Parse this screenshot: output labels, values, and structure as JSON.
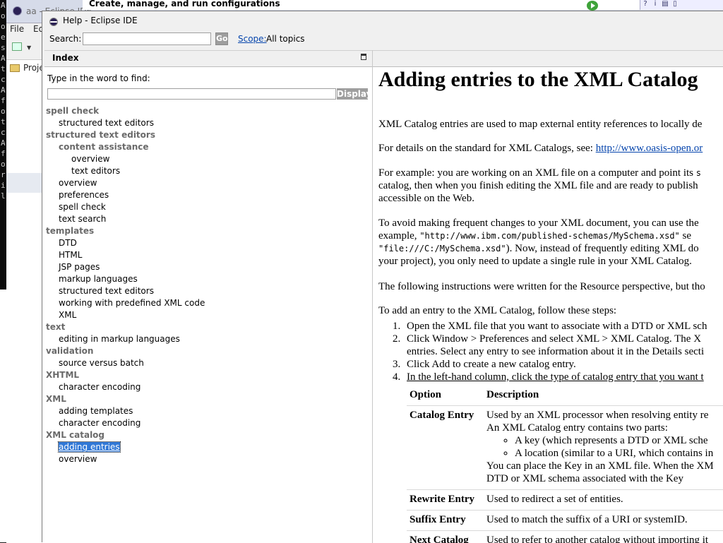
{
  "background": {
    "console_strip": [
      "A",
      "o",
      "o",
      "e",
      "",
      "",
      "",
      "s",
      "A",
      "t",
      "c",
      "A",
      "f",
      "o",
      "t",
      "c",
      "A",
      "f",
      "o",
      "r",
      "i",
      "l"
    ],
    "ide_title": "aa - Eclipse IDE",
    "menu": {
      "file": "File",
      "edit": "Ed"
    },
    "project_tab": "Proje",
    "wizard_title": "Create, manage, and run configurations"
  },
  "help": {
    "window_title": "Help - Eclipse IDE",
    "search": {
      "label": "Search:",
      "value": "",
      "go_label": "Go"
    },
    "scope": {
      "label": "Scope:",
      "value": "All topics"
    },
    "index": {
      "title": "Index",
      "prompt": "Type in the word to find:",
      "input_value": "",
      "display_label": "Display",
      "entries": [
        {
          "label": "spell check",
          "level": 0
        },
        {
          "label": "structured text editors",
          "level": 1
        },
        {
          "label": "structured text editors",
          "level": 0
        },
        {
          "label": "content assistance",
          "level": 1,
          "bold": true
        },
        {
          "label": "overview",
          "level": 2
        },
        {
          "label": "text editors",
          "level": 2
        },
        {
          "label": "overview",
          "level": 1
        },
        {
          "label": "preferences",
          "level": 1
        },
        {
          "label": "spell check",
          "level": 1
        },
        {
          "label": "text search",
          "level": 1
        },
        {
          "label": "templates",
          "level": 0
        },
        {
          "label": "DTD",
          "level": 1
        },
        {
          "label": "HTML",
          "level": 1
        },
        {
          "label": "JSP pages",
          "level": 1
        },
        {
          "label": "markup languages",
          "level": 1
        },
        {
          "label": "structured text editors",
          "level": 1
        },
        {
          "label": "working with predefined XML code",
          "level": 1
        },
        {
          "label": "XML",
          "level": 1
        },
        {
          "label": "text",
          "level": 0
        },
        {
          "label": "editing in markup languages",
          "level": 1
        },
        {
          "label": "validation",
          "level": 0
        },
        {
          "label": "source versus batch",
          "level": 1
        },
        {
          "label": "XHTML",
          "level": 0
        },
        {
          "label": "character encoding",
          "level": 1
        },
        {
          "label": "XML",
          "level": 0
        },
        {
          "label": "adding templates",
          "level": 1
        },
        {
          "label": "character encoding",
          "level": 1
        },
        {
          "label": "XML catalog",
          "level": 0
        },
        {
          "label": "adding entries",
          "level": 1,
          "selected": true
        },
        {
          "label": "overview",
          "level": 1
        }
      ]
    },
    "content": {
      "heading": "Adding entries to the XML Catalog",
      "p1": "XML Catalog entries are used to map external entity references to locally de",
      "p2_prefix": "For details on the standard for XML Catalogs, see: ",
      "p2_link": "http://www.oasis-open.or",
      "p3_a": "For example: you are working on an XML file on a computer and point its ",
      "p3_a_code": "s",
      "p3_b": "catalog, then when you finish editing the XML file and are ready to publish",
      "p3_c": "accessible on the Web.",
      "p4_a": "To avoid making frequent changes to your XML document, you can use the",
      "p4_b_prefix": "example, ",
      "p4_b_code": "\"http://www.ibm.com/published-schemas/MySchema.xsd\"",
      "p4_b_suffix": " se",
      "p4_c_code": "\"file:///C:/MySchema.xsd\"",
      "p4_c_suffix": "). Now, instead of frequently editing XML do",
      "p4_d": "your project), you only need to update a single rule in your XML Catalog.",
      "p5": "The following instructions were written for the Resource perspective, but tho",
      "p6": "To add an entry to the XML Catalog, follow these steps:",
      "steps": [
        {
          "num": "1.",
          "text": "Open the XML file that you want to associate with a DTD or XML sch"
        },
        {
          "num": "2.",
          "text": "Click Window > Preferences and select XML > XML Catalog. The X"
        },
        {
          "num": "",
          "text": "entries. Select any entry to see information about it in the Details secti"
        },
        {
          "num": "3.",
          "text": "Click Add to create a new catalog entry."
        },
        {
          "num": "4.",
          "text": "In the left-hand column, click the type of catalog entry that you want t"
        }
      ],
      "table": {
        "headers": [
          "Option",
          "Description"
        ],
        "rows": [
          {
            "option": "Catalog Entry",
            "d1": "Used by an XML processor when resolving entity re",
            "d2": "An XML Catalog entry contains two parts:",
            "bullet1": "A key (which represents a DTD or XML sche",
            "bullet2": "A location (similar to a URI, which contains in",
            "d3": "You can place the Key in an XML file. When the XM",
            "d4": "DTD or XML schema associated with the Key"
          },
          {
            "option": "Rewrite Entry",
            "d1": "Used to redirect a set of entities."
          },
          {
            "option": "Suffix Entry",
            "d1": "Used to match the suffix of a URI or systemID."
          },
          {
            "option": "Next Catalog",
            "d1": "Used to refer to another catalog without importing it"
          }
        ]
      }
    }
  }
}
